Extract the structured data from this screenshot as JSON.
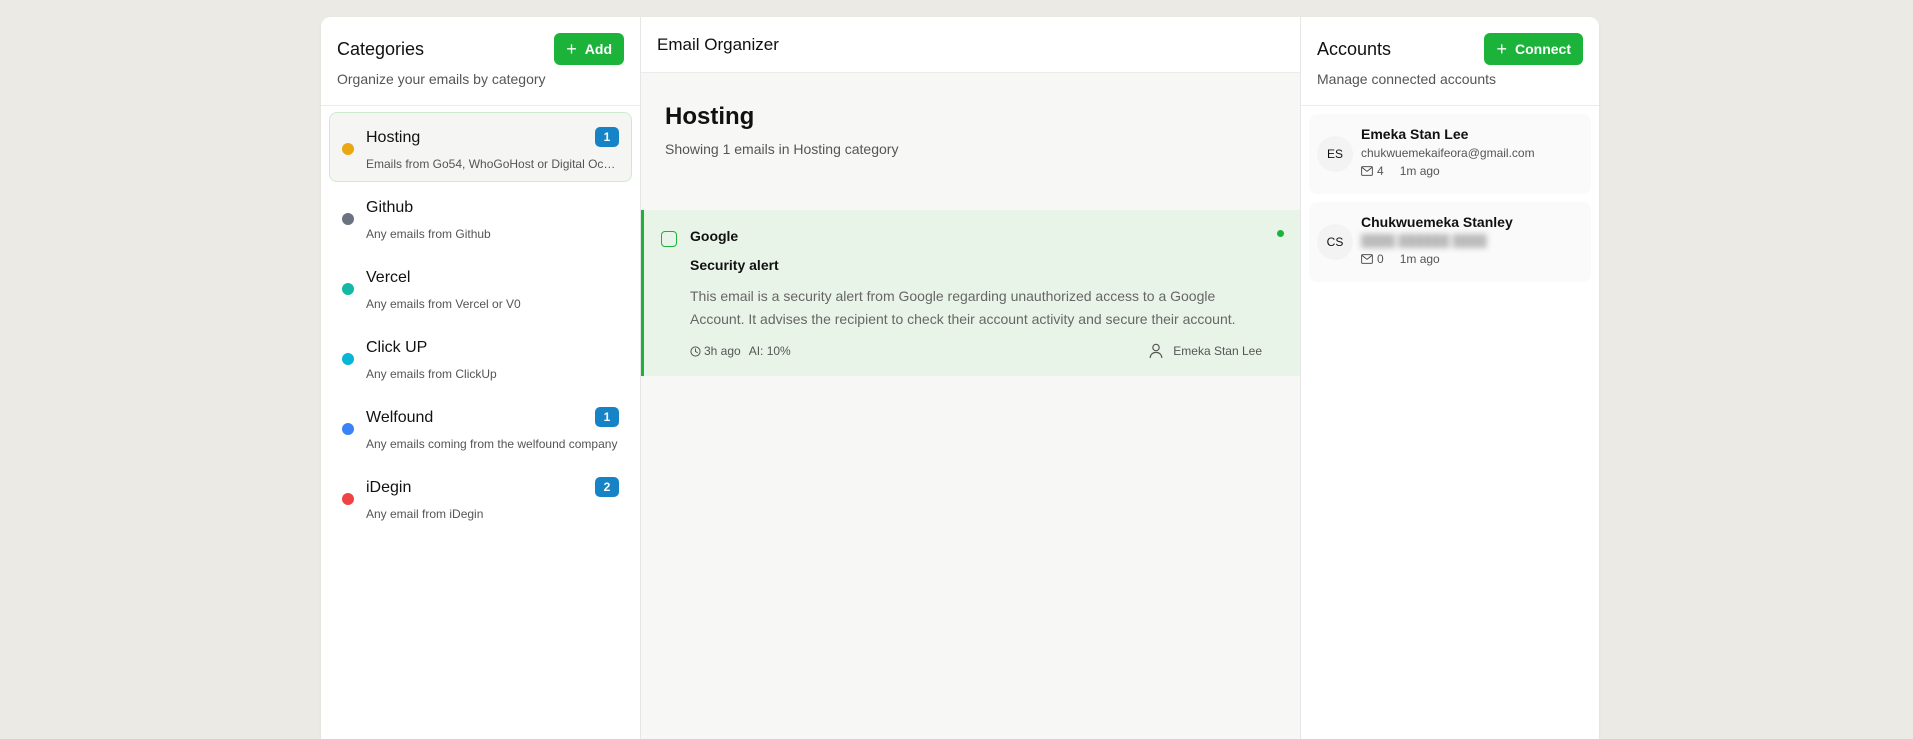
{
  "categories_panel": {
    "title": "Categories",
    "subtitle": "Organize your emails by category",
    "add_label": "Add",
    "items": [
      {
        "name": "Hosting",
        "desc": "Emails from Go54, WhoGoHost or Digital Ocean",
        "count": "1",
        "color": "#eaa712"
      },
      {
        "name": "Github",
        "desc": "Any emails from Github",
        "count": "",
        "color": "#6b7280"
      },
      {
        "name": "Vercel",
        "desc": "Any emails from Vercel or V0",
        "count": "",
        "color": "#14b8a6"
      },
      {
        "name": "Click UP",
        "desc": "Any emails from ClickUp",
        "count": "",
        "color": "#06b6d4"
      },
      {
        "name": "Welfound",
        "desc": "Any emails coming from the welfound company",
        "count": "1",
        "color": "#3b82f6"
      },
      {
        "name": "iDegin",
        "desc": "Any email from iDegin",
        "count": "2",
        "color": "#ef4444"
      }
    ]
  },
  "main": {
    "app_title": "Email Organizer",
    "category_heading": "Hosting",
    "category_sub": "Showing 1 emails in Hosting category",
    "emails": [
      {
        "from": "Google",
        "subject": "Security alert",
        "summary": "This email is a security alert from Google regarding unauthorized access to a Google Account. It advises the recipient to check their account activity and secure their account.",
        "time": "3h ago",
        "ai": "AI: 10%",
        "account": "Emeka Stan Lee"
      }
    ]
  },
  "accounts_panel": {
    "title": "Accounts",
    "subtitle": "Manage connected accounts",
    "connect_label": "Connect",
    "items": [
      {
        "initials": "ES",
        "name": "Emeka Stan Lee",
        "email": "chukwuemekaifeora@gmail.com",
        "count": "4",
        "ago": "1m ago"
      },
      {
        "initials": "CS",
        "name": "Chukwuemeka Stanley",
        "email": "",
        "count": "0",
        "ago": "1m ago"
      }
    ]
  },
  "colors": {
    "accent": "#1bb33a",
    "badge": "#1783c7"
  }
}
